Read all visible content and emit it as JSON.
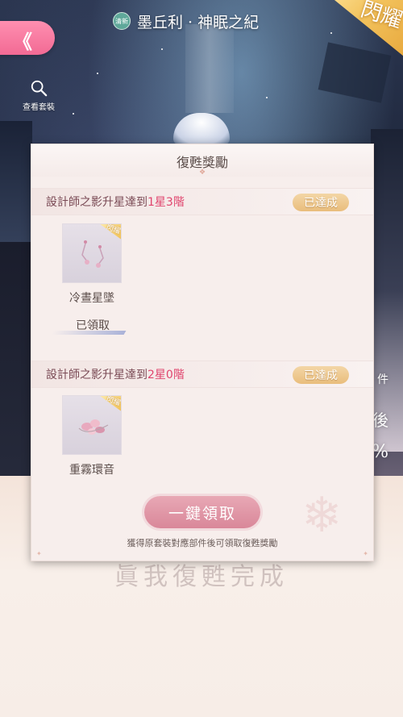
{
  "header": {
    "back_icon": "double-chevron-left-icon",
    "badge": "清新",
    "title": "墨丘利 · 神眠之紀",
    "rank_tag": "閃耀"
  },
  "view_set": {
    "icon": "search-icon",
    "label": "查看套裝"
  },
  "side_texts": [
    "件",
    "後",
    "%"
  ],
  "background_caption": "眞我復甦完成",
  "modal": {
    "title": "復甦獎勵",
    "tasks": [
      {
        "text_prefix": "設計師之影升星達到",
        "text_highlight": "1星3階",
        "status": "已達成",
        "reward": {
          "name": "冷晝星墜",
          "flag": "閃耀",
          "claimed_label": "已領取"
        }
      },
      {
        "text_prefix": "設計師之影升星達到",
        "text_highlight": "2星0階",
        "status": "已達成",
        "reward": {
          "name": "重霧環音",
          "flag": "閃耀"
        }
      }
    ],
    "claim_all_label": "一鍵領取",
    "hint": "獲得原套裝對應部件後可領取復甦獎勵"
  },
  "colors": {
    "accent_pink": "#f26a94",
    "highlight": "#e0456e",
    "done_badge": "#e9bd7c",
    "claim_button": "#d98799"
  }
}
